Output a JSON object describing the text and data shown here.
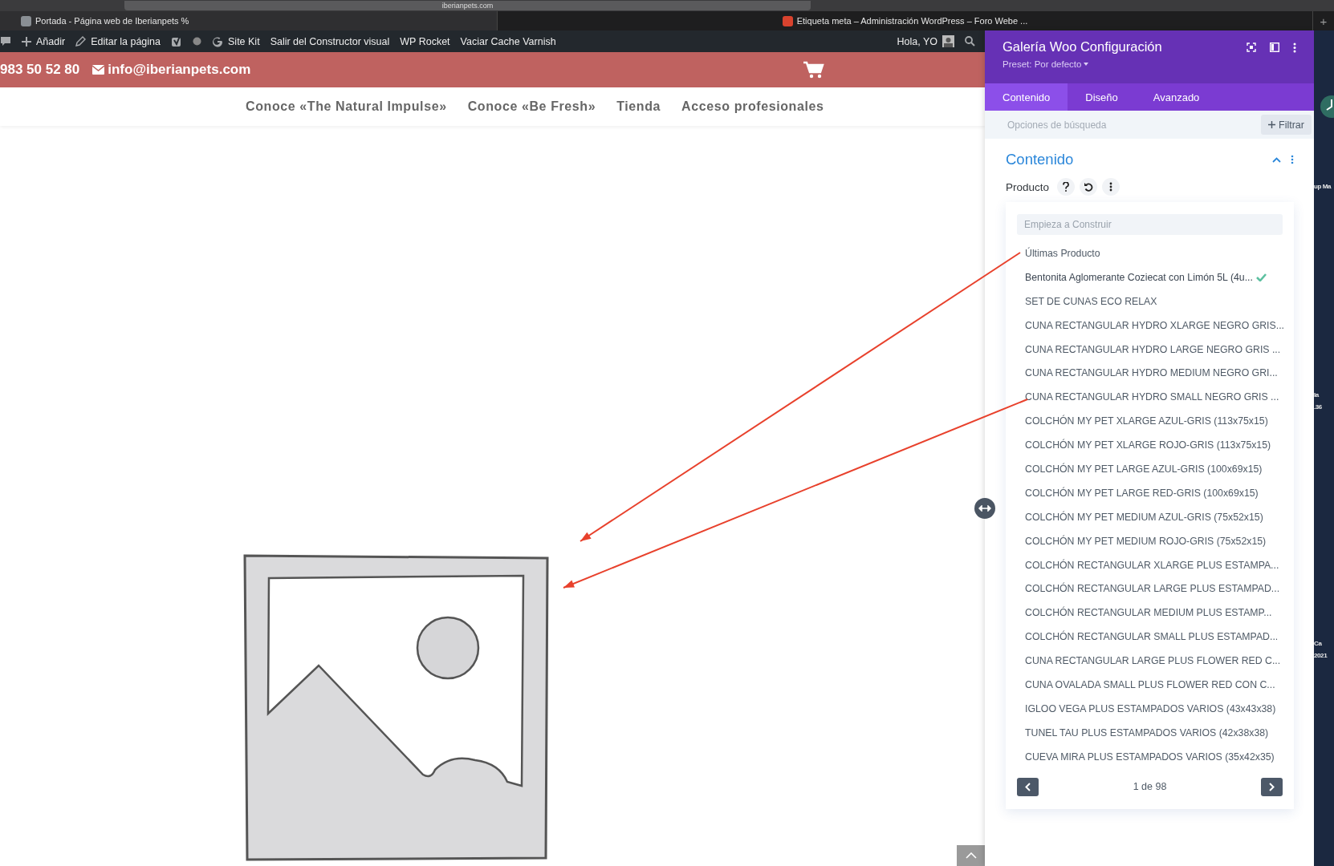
{
  "browser": {
    "address": "iberianpets.com",
    "new_tab": "+",
    "tabs": [
      {
        "title": "Portada - Página web de Iberianpets %",
        "selected": true
      },
      {
        "title": "Etiqueta meta – Administración WordPress – Foro Webe ...",
        "selected": false
      }
    ]
  },
  "admin_bar": {
    "items": [
      {
        "kind": "comment"
      },
      {
        "kind": "add",
        "label": "Añadir"
      },
      {
        "kind": "edit",
        "label": "Editar la página"
      },
      {
        "kind": "yoast"
      },
      {
        "kind": "status"
      },
      {
        "kind": "google",
        "label": "Site Kit"
      },
      {
        "kind": "text",
        "label": "Salir del Constructor visual"
      },
      {
        "kind": "text",
        "label": "WP Rocket"
      },
      {
        "kind": "text",
        "label": "Vaciar Cache Varnish"
      }
    ],
    "greeting": "Hola, YO"
  },
  "header": {
    "phone": "983 50 52 80",
    "email": "info@iberianpets.com"
  },
  "nav": [
    "Conoce «The Natural Impulse»",
    "Conoce «Be Fresh»",
    "Tienda",
    "Acceso profesionales"
  ],
  "panel": {
    "title": "Galería Woo Configuración",
    "preset": "Preset: Por defecto",
    "tabs": [
      {
        "label": "Contenido",
        "selected": true
      },
      {
        "label": "Diseño",
        "selected": false
      },
      {
        "label": "Avanzado",
        "selected": false
      }
    ],
    "search": {
      "placeholder": "Opciones de búsqueda"
    },
    "filter_button": "Filtrar",
    "section": {
      "title": "Contenido",
      "expanded": true,
      "field_label": "Producto",
      "dropdown": {
        "search": {
          "placeholder": "Empieza a Construir"
        },
        "items": [
          {
            "label": "Últimas Producto",
            "selected": false
          },
          {
            "label": "Bentonita Aglomerante Coziecat con Limón 5L (4u...",
            "selected": true
          },
          {
            "label": "SET DE CUNAS ECO RELAX",
            "selected": false
          },
          {
            "label": "CUNA RECTANGULAR HYDRO XLARGE NEGRO GRIS...",
            "selected": false
          },
          {
            "label": "CUNA RECTANGULAR HYDRO LARGE NEGRO GRIS ...",
            "selected": false
          },
          {
            "label": "CUNA RECTANGULAR HYDRO MEDIUM NEGRO GRI...",
            "selected": false
          },
          {
            "label": "CUNA RECTANGULAR HYDRO SMALL NEGRO GRIS ...",
            "selected": false
          },
          {
            "label": "COLCHÓN MY PET XLARGE AZUL-GRIS (113x75x15)",
            "selected": false
          },
          {
            "label": "COLCHÓN MY PET XLARGE ROJO-GRIS (113x75x15)",
            "selected": false
          },
          {
            "label": "COLCHÓN MY PET LARGE AZUL-GRIS (100x69x15)",
            "selected": false
          },
          {
            "label": "COLCHÓN MY PET LARGE RED-GRIS (100x69x15)",
            "selected": false
          },
          {
            "label": "COLCHÓN MY PET MEDIUM AZUL-GRIS (75x52x15)",
            "selected": false
          },
          {
            "label": "COLCHÓN MY PET MEDIUM ROJO-GRIS (75x52x15)",
            "selected": false
          },
          {
            "label": "COLCHÓN RECTANGULAR XLARGE PLUS ESTAMPA...",
            "selected": false
          },
          {
            "label": "COLCHÓN RECTANGULAR LARGE PLUS ESTAMPAD...",
            "selected": false
          },
          {
            "label": "COLCHÓN RECTANGULAR MEDIUM PLUS ESTAMP...",
            "selected": false
          },
          {
            "label": "COLCHÓN RECTANGULAR SMALL PLUS ESTAMPAD...",
            "selected": false
          },
          {
            "label": "CUNA RECTANGULAR LARGE PLUS FLOWER RED C...",
            "selected": false
          },
          {
            "label": "CUNA OVALADA SMALL PLUS FLOWER RED CON C...",
            "selected": false
          },
          {
            "label": "IGLOO VEGA PLUS ESTAMPADOS VARIOS (43x43x38)",
            "selected": false
          },
          {
            "label": "TUNEL TAU PLUS ESTAMPADOS VARIOS (42x38x38)",
            "selected": false
          },
          {
            "label": "CUEVA MIRA PLUS ESTAMPADOS VARIOS (35x42x35)",
            "selected": false
          }
        ],
        "page": "1 de 98"
      }
    }
  },
  "desktop": {
    "labels": [
      "up Ma",
      "la",
      ".36",
      "Ca",
      "2021"
    ]
  }
}
